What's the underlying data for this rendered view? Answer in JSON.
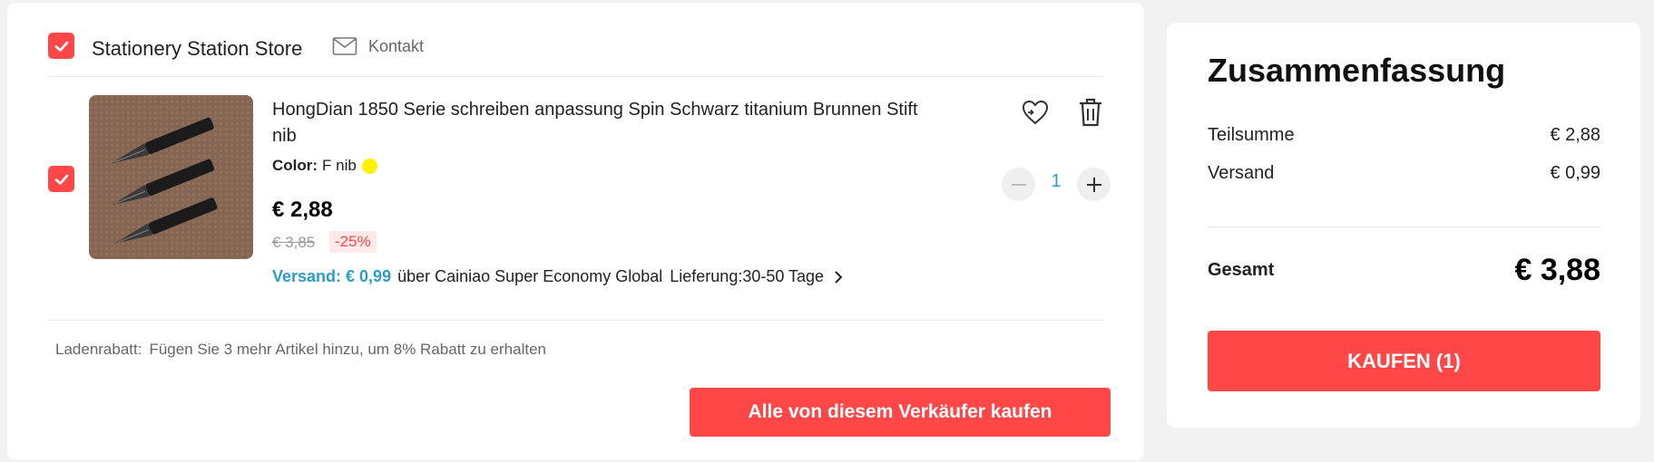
{
  "store": {
    "checked": true,
    "name": "Stationery Station Store",
    "contact_label": "Kontakt"
  },
  "item": {
    "checked": true,
    "title": "HongDian 1850 Serie schreiben anpassung Spin Schwarz titanium Brunnen Stift nib",
    "color_label": "Color:",
    "color_value": "F nib",
    "color_swatch": "#fff200",
    "price": "€ 2,88",
    "old_price": "€ 3,85",
    "discount": "-25%",
    "shipping_cost": "Versand: € 0,99",
    "shipping_method": "über Cainiao Super Economy Global",
    "delivery": "Lieferung:30-50 Tage",
    "quantity": "1"
  },
  "store_discount": {
    "label": "Ladenrabatt:",
    "text": "Fügen Sie 3 mehr Artikel hinzu, um 8% Rabatt zu erhalten"
  },
  "buy_all_label": "Alle von diesem Verkäufer kaufen",
  "summary": {
    "title": "Zusammenfassung",
    "subtotal_label": "Teilsumme",
    "subtotal_value": "€ 2,88",
    "shipping_label": "Versand",
    "shipping_value": "€ 0,99",
    "total_label": "Gesamt",
    "total_value": "€ 3,88",
    "buy_label": "KAUFEN (1)"
  },
  "colors": {
    "accent": "#ff4747",
    "link_blue": "#2e9cc9"
  }
}
